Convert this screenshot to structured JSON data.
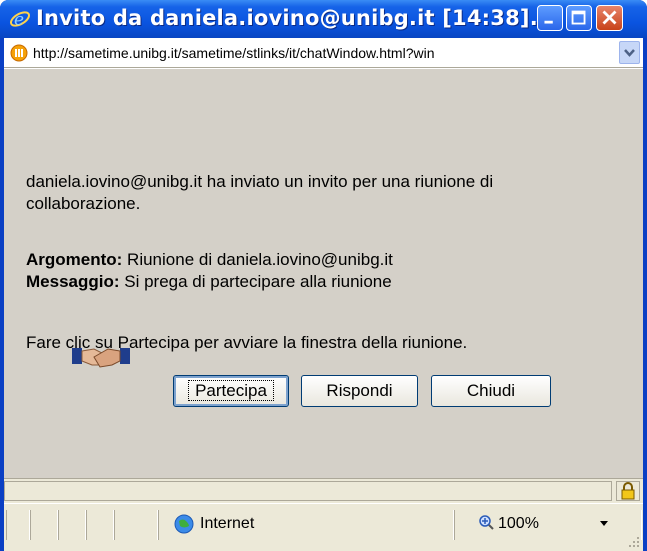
{
  "window": {
    "title": "Invito da daniela.iovino@unibg.it [14:38]...",
    "icon": "ie-icon"
  },
  "address": {
    "url": "http://sametime.unibg.it/sametime/stlinks/it/chatWindow.html?win"
  },
  "content": {
    "intro": "daniela.iovino@unibg.it ha inviato un invito per una riunione di",
    "intro2": "collaborazione.",
    "topic_label": "Argomento:",
    "topic_value": " Riunione di daniela.iovino@unibg.it",
    "message_label": "Messaggio:",
    "message_value": " Si prega di partecipare alla riunione",
    "instruction": "Fare clic su Partecipa per avviare la finestra della riunione."
  },
  "buttons": {
    "join": "Partecipa",
    "reply": "Rispondi",
    "close": "Chiudi"
  },
  "statusbar": {
    "zone": "Internet",
    "zoom": "100%"
  }
}
